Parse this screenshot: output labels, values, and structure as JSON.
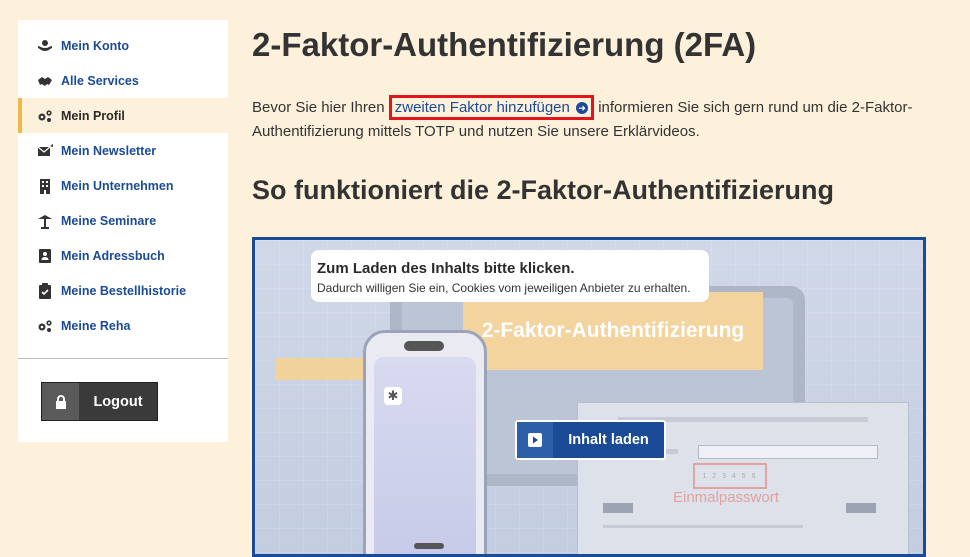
{
  "sidebar": {
    "items": [
      {
        "label": "Mein Konto",
        "icon": "user-hands-icon"
      },
      {
        "label": "Alle Services",
        "icon": "handshake-icon"
      },
      {
        "label": "Mein Profil",
        "icon": "gears-icon",
        "active": true
      },
      {
        "label": "Mein Newsletter",
        "icon": "envelope-icon"
      },
      {
        "label": "Mein Unternehmen",
        "icon": "building-icon"
      },
      {
        "label": "Meine Seminare",
        "icon": "lectern-icon"
      },
      {
        "label": "Mein Adressbuch",
        "icon": "address-book-icon"
      },
      {
        "label": "Meine Bestellhistorie",
        "icon": "clipboard-check-icon"
      },
      {
        "label": "Meine Reha",
        "icon": "gears-icon"
      }
    ],
    "logout_label": "Logout"
  },
  "main": {
    "title": "2-Faktor-Authentifizierung (2FA)",
    "intro_before": "Bevor Sie hier Ihren ",
    "intro_link": "zweiten Faktor hinzufügen",
    "intro_after": " informieren Sie sich gern rund um die 2-Faktor-Authentifizierung mittels TOTP und nutzen Sie unsere Erklärvideos.",
    "section_title": "So funktioniert die 2-Faktor-Authentifizierung"
  },
  "video": {
    "consent_title": "Zum Laden des Inhalts bitte klicken.",
    "consent_text": "Dadurch willigen Sie ein, Cookies vom jeweiligen Anbieter zu erhalten.",
    "load_label": "Inhalt laden",
    "preview_banner": "2-Faktor-Authentifizierung",
    "preview_otp": "1 2 3 4 5 6",
    "preview_otp_label": "Einmalpasswort"
  },
  "colors": {
    "accent": "#1b4b96",
    "active_marker": "#f1b748",
    "highlight_border": "#e3141b",
    "background": "#fdf1dc"
  }
}
